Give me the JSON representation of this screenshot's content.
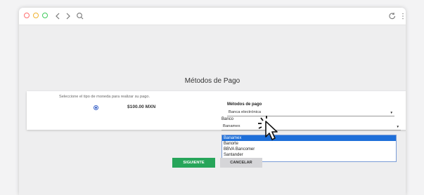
{
  "browser": {
    "icons": [
      "close-dot",
      "minimize-dot",
      "maximize-dot",
      "back-icon",
      "forward-icon",
      "search-icon",
      "reload-icon",
      "menu-icon"
    ]
  },
  "page": {
    "title": "Métodos de Pago",
    "prompt": "Seleccione el tipo de moneda para realizar su pago.",
    "price": "$100.00 MXN",
    "metodos_label": "Métodos de pago",
    "metodo_value": "Banca electrónica",
    "banco_label": "Banco",
    "banco_value": "Banamex",
    "banco_options": [
      "Banamex",
      "Banorte",
      "BBVA Bancomer",
      "Santander"
    ],
    "selected_option_index": 0,
    "siguiente_label": "SIGUIENTE",
    "cancelar_label": "CANCELAR"
  },
  "colors": {
    "accent_green": "#27a55a",
    "selection_blue": "#1e6fd9",
    "cancel_gray": "#d5d5d8"
  }
}
